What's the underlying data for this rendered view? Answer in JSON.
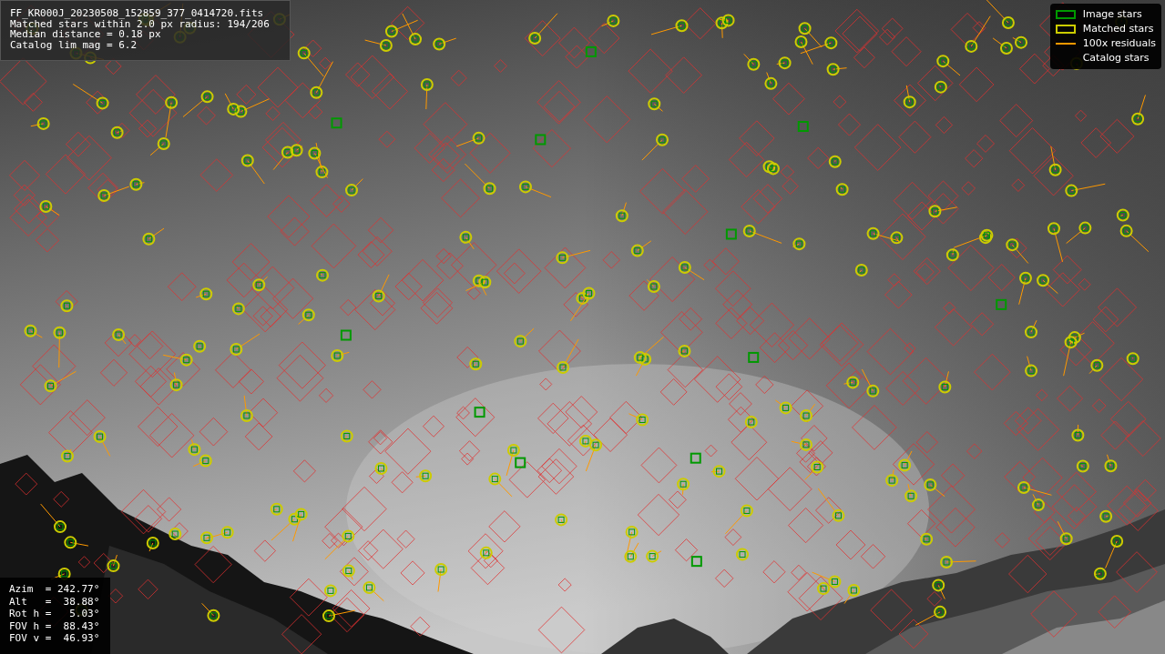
{
  "info_box": {
    "lines": [
      "FF_KR000J_20230508_152859_377_0414720.fits",
      "Matched stars within 2.0 px radius: 194/206",
      "Median distance = 0.18 px",
      "Catalog lim mag = 6.2"
    ]
  },
  "legend": {
    "items": [
      {
        "label": "Image stars",
        "kind": "box",
        "color": "#009900"
      },
      {
        "label": "Matched stars",
        "kind": "box",
        "color": "#cccc00"
      },
      {
        "label": "100x residuals",
        "kind": "line",
        "color": "#ff9900"
      },
      {
        "label": "Catalog stars",
        "kind": "none"
      }
    ]
  },
  "pointing": {
    "lines": [
      "Azim  = 242.77°",
      "Alt   =  38.88°",
      "Rot h =   5.03°",
      "FOV h =  88.43°",
      "FOV v =  46.93°"
    ]
  }
}
